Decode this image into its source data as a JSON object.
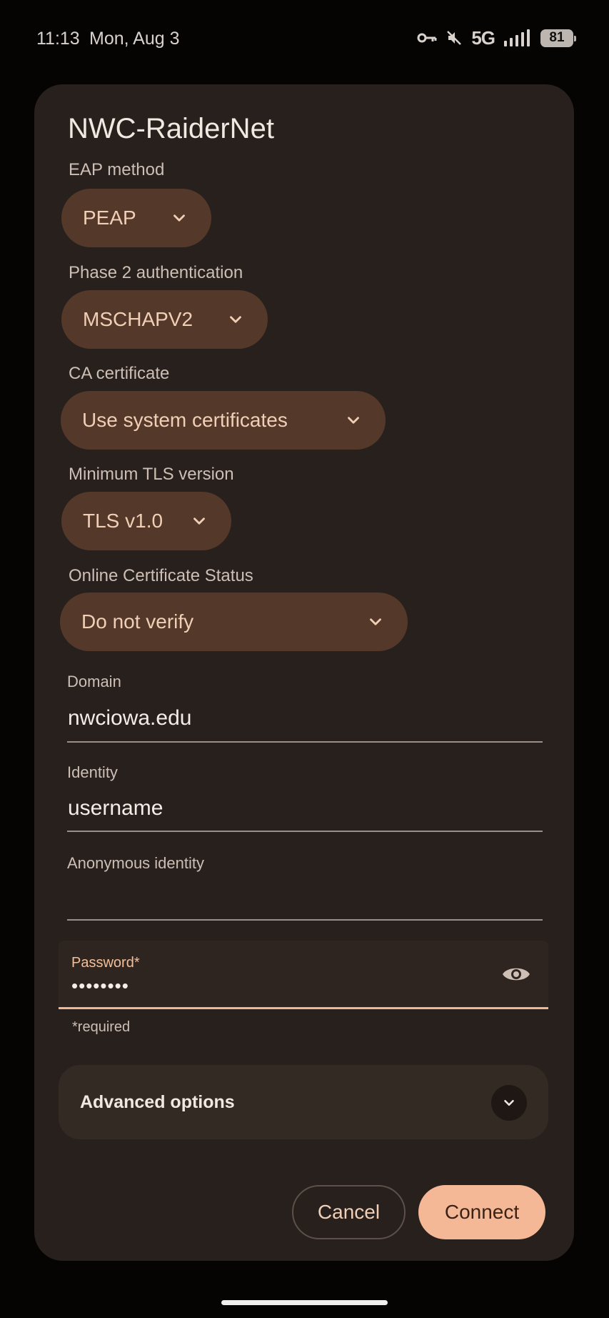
{
  "status_bar": {
    "time": "11:13",
    "date": "Mon, Aug 3",
    "network": "5G",
    "battery": "81",
    "icons": [
      "vpn-key-icon",
      "mute-icon",
      "signal-icon",
      "battery-icon"
    ]
  },
  "dialog": {
    "title": "NWC-RaiderNet",
    "eap_method": {
      "label": "EAP method",
      "value": "PEAP"
    },
    "phase2": {
      "label": "Phase 2 authentication",
      "value": "MSCHAPV2"
    },
    "ca_certificate": {
      "label": "CA certificate",
      "value": "Use system certificates"
    },
    "min_tls": {
      "label": "Minimum TLS version",
      "value": "TLS v1.0"
    },
    "ocsp": {
      "label": "Online Certificate Status",
      "value": "Do not verify"
    },
    "domain": {
      "label": "Domain",
      "value": "nwciowa.edu"
    },
    "identity": {
      "label": "Identity",
      "value": "username"
    },
    "anonymous_identity": {
      "label": "Anonymous identity",
      "value": ""
    },
    "password": {
      "label": "Password*",
      "value": "••••••••",
      "helper": "*required"
    },
    "advanced": {
      "label": "Advanced options"
    },
    "buttons": {
      "cancel": "Cancel",
      "connect": "Connect"
    }
  },
  "colors": {
    "accent": "#f4b896",
    "dialog_bg": "#28201c",
    "pill_bg": "#54392a"
  }
}
